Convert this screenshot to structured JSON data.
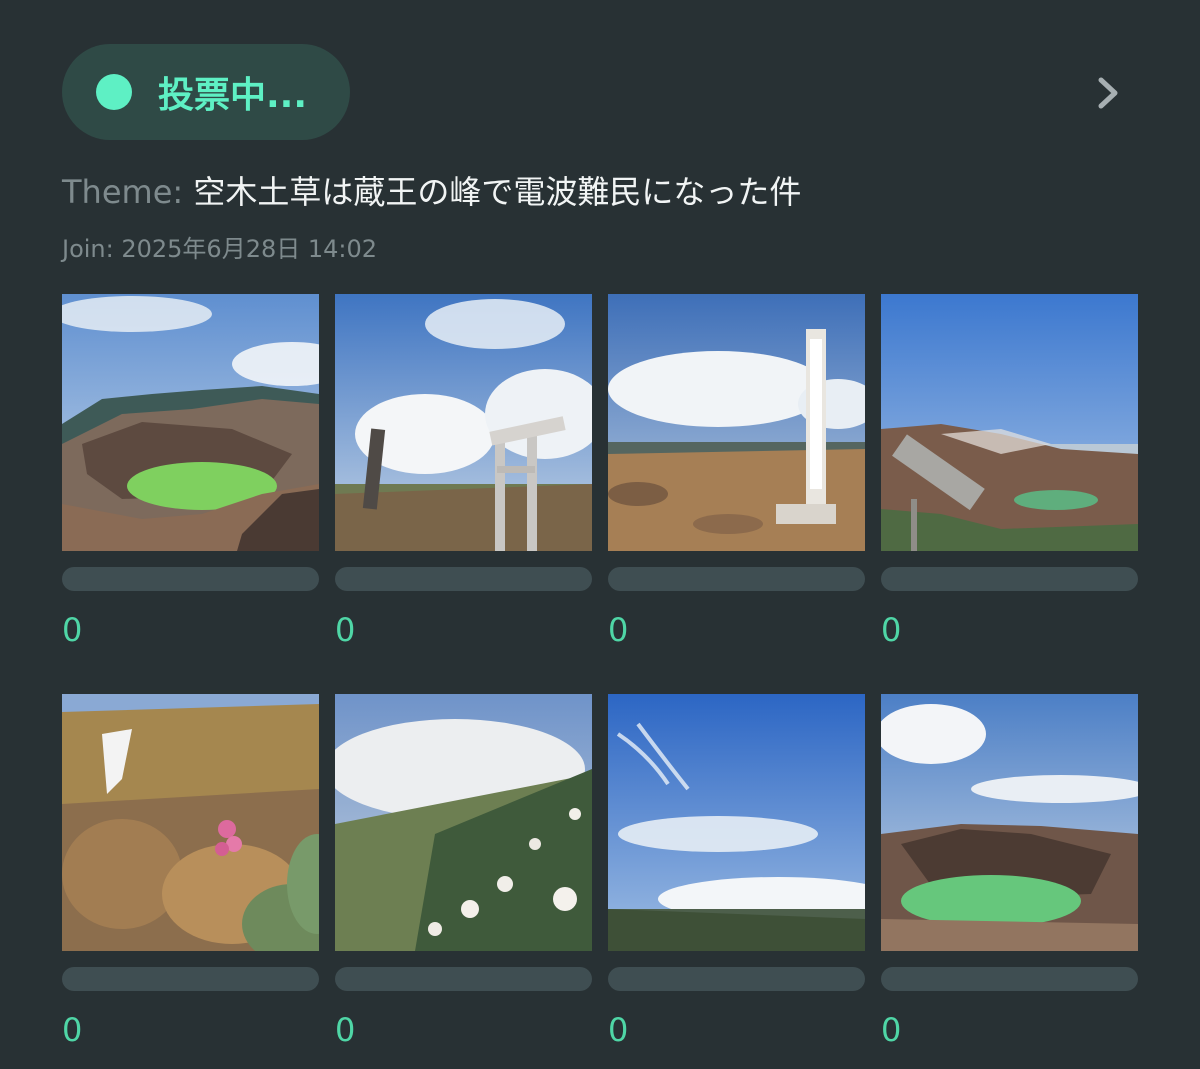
{
  "status": {
    "label": "投票中...",
    "accent": "#5ef0c4"
  },
  "header": {
    "next_icon": "chevron-right-icon"
  },
  "theme": {
    "label": "Theme:",
    "text": "空木土草は蔵王の峰で電波難民になった件"
  },
  "join": {
    "text": "Join: 2025年6月28日 14:02"
  },
  "entries": [
    {
      "count": "0"
    },
    {
      "count": "0"
    },
    {
      "count": "0"
    },
    {
      "count": "0"
    },
    {
      "count": "0"
    },
    {
      "count": "0"
    },
    {
      "count": "0"
    },
    {
      "count": "0"
    }
  ]
}
